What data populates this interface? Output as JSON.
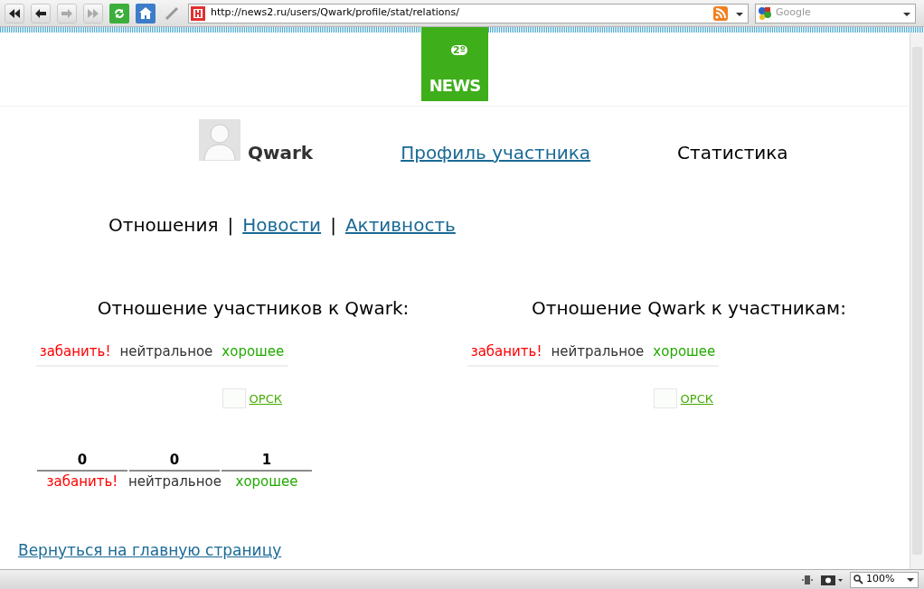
{
  "toolbar": {
    "url": "http://news2.ru/users/Qwark/profile/stat/relations/",
    "search_placeholder": "Google"
  },
  "logo": {
    "badge": "2º",
    "text": "NEWS"
  },
  "header": {
    "username": "Qwark",
    "profile_link": "Профиль участника",
    "stats_label": "Статистика"
  },
  "subnav": [
    {
      "label": "Отношения",
      "selected": true
    },
    {
      "label": "Новости",
      "selected": false
    },
    {
      "label": "Активность",
      "selected": false
    }
  ],
  "subnav_separators": [
    "|",
    "|"
  ],
  "panels": [
    {
      "title": "Отношение участников к Qwark:",
      "ratings": [
        {
          "kind": "ban",
          "label": "забанить!"
        },
        {
          "kind": "neutral",
          "label": "нейтральное"
        },
        {
          "kind": "good",
          "label": "хорошее"
        }
      ],
      "entry": "ОРСК"
    },
    {
      "title": "Отношение Qwark к участникам:",
      "ratings": [
        {
          "kind": "ban",
          "label": "забанить!"
        },
        {
          "kind": "neutral",
          "label": "нейтральное"
        },
        {
          "kind": "good",
          "label": "хорошее"
        }
      ],
      "entry": "ОРСК"
    }
  ],
  "summary": [
    {
      "kind": "ban",
      "count": "0",
      "label": "забанить!"
    },
    {
      "kind": "neutral",
      "count": "0",
      "label": "нейтральное"
    },
    {
      "kind": "good",
      "count": "1",
      "label": "хорошее"
    }
  ],
  "back_link": "Вернуться на главную страницу",
  "status_bar": {
    "zoom": "100%"
  }
}
